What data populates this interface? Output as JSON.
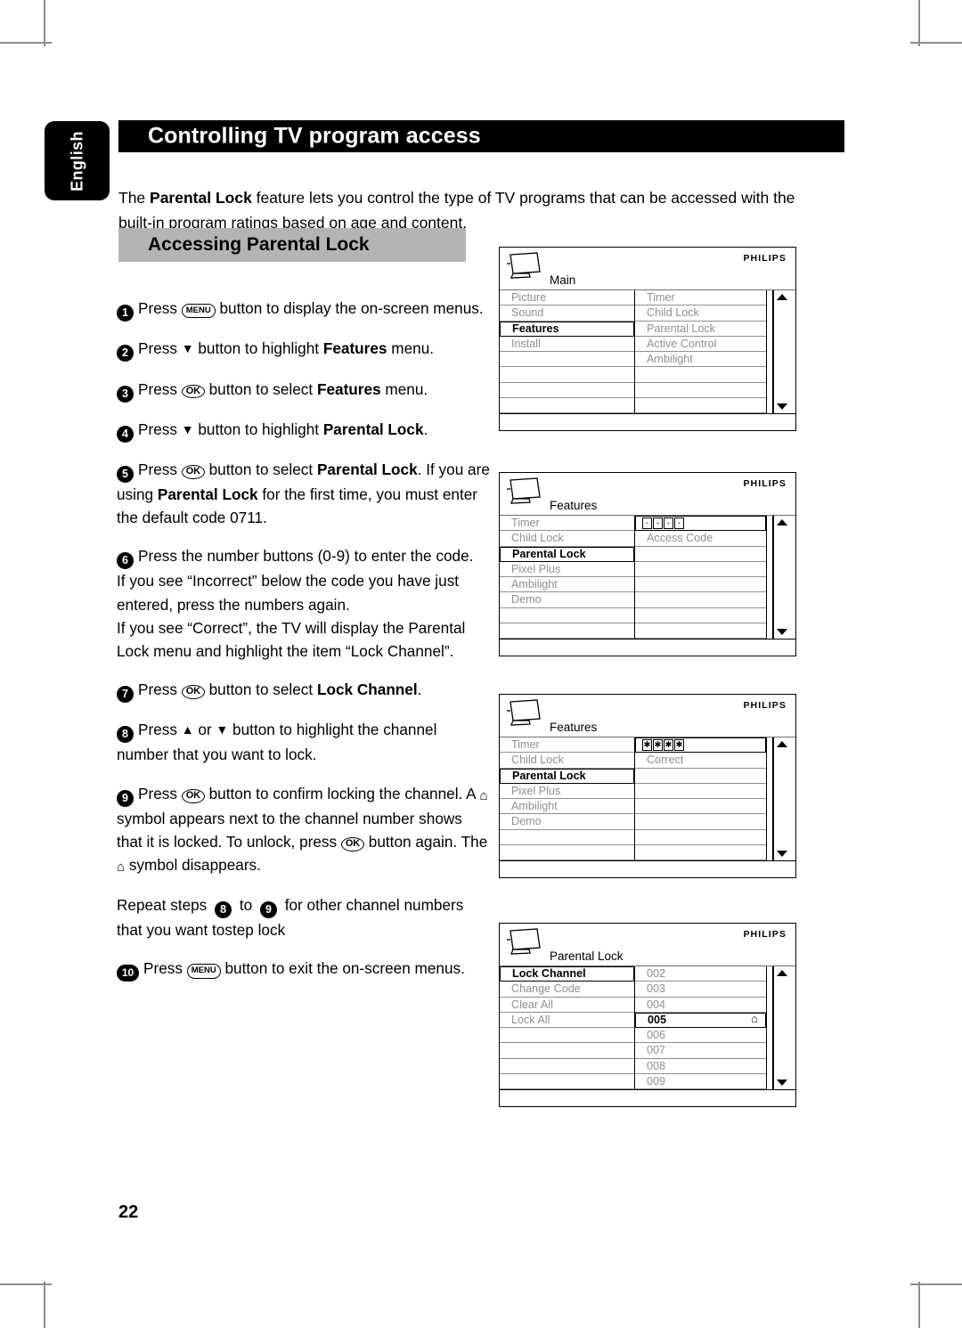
{
  "page": {
    "number": "22",
    "language_tab": "English",
    "title": "Controlling TV program access",
    "intro_prefix": "The ",
    "intro_bold": "Parental Lock",
    "intro_suffix": " feature lets you control the type of TV programs that can be accessed with the built-in program ratings based on age and content.",
    "section_heading": "Accessing Parental Lock"
  },
  "keys": {
    "menu": "MENU",
    "ok": "OK",
    "down": "▼",
    "up": "▲",
    "lock": "⌂"
  },
  "steps": {
    "s1": {
      "num": "1",
      "a": "Press ",
      "key": "MENU",
      "b": " button to display the on-screen menus."
    },
    "s2": {
      "num": "2",
      "a": "Press ",
      "key": "▼",
      "b": " button to highlight ",
      "bold": "Features",
      "c": " menu."
    },
    "s3": {
      "num": "3",
      "a": "Press ",
      "key": "OK",
      "b": " button to select ",
      "bold": "Features",
      "c": " menu."
    },
    "s4": {
      "num": "4",
      "a": "Press ",
      "key": "▼",
      "b": " button to highlight ",
      "bold": "Parental Lock",
      "c": "."
    },
    "s5": {
      "num": "5",
      "a": "Press ",
      "key": "OK",
      "b": " button to select ",
      "bold": "Parental Lock",
      "c": ". If you are using ",
      "bold2": "Parental Lock",
      "d": " for the first time, you must enter the default code 0711."
    },
    "s6": {
      "num": "6",
      "a": "Press the number buttons (0-9) to enter the code.",
      "b": "If you see “Incorrect” below the code you have just entered, press the numbers again.",
      "c": "If you see “Correct”, the TV will display the Parental Lock menu and highlight the item “Lock Channel”."
    },
    "s7": {
      "num": "7",
      "a": "Press ",
      "key": "OK",
      "b": " button to select ",
      "bold": "Lock Channel",
      "c": "."
    },
    "s8": {
      "num": "8",
      "a": "Press ",
      "key_up": "▲",
      "mid": " or ",
      "key_down": "▼",
      "b": " button to highlight the channel number that you want to lock."
    },
    "s9": {
      "num": "9",
      "a": "Press ",
      "key": "OK",
      "b": " button to confirm locking the channel.  A ",
      "lock1": "⌂",
      "c": " symbol appears next to the channel number shows that it is locked. To unlock, press ",
      "key2": "OK",
      "d": " button again. The ",
      "lock2": "⌂",
      "e": " symbol disappears."
    },
    "repeat": {
      "a": "Repeat steps ",
      "from": "8",
      "mid": " to ",
      "to": "9",
      "b": " for other channel numbers that you want tostep lock"
    },
    "s10": {
      "num": "10",
      "a": "Press ",
      "key": "MENU",
      "b": " button to exit the on-screen menus."
    }
  },
  "osd": {
    "brand": "PHILIPS",
    "menu1": {
      "title": "Main",
      "left": [
        {
          "label": "Picture",
          "selected": false
        },
        {
          "label": "Sound",
          "selected": false
        },
        {
          "label": "Features",
          "selected": true
        },
        {
          "label": "Install",
          "selected": false
        },
        {
          "label": "",
          "selected": false
        },
        {
          "label": "",
          "selected": false
        },
        {
          "label": "",
          "selected": false
        },
        {
          "label": "",
          "selected": false
        }
      ],
      "right": [
        {
          "label": "Timer",
          "selected": false
        },
        {
          "label": "Child Lock",
          "selected": false
        },
        {
          "label": "Parental Lock",
          "selected": false
        },
        {
          "label": "Active Control",
          "selected": false
        },
        {
          "label": "Ambilight",
          "selected": false
        },
        {
          "label": "",
          "selected": false
        },
        {
          "label": "",
          "selected": false
        },
        {
          "label": "",
          "selected": false
        }
      ]
    },
    "menu2": {
      "title": "Features",
      "left": [
        {
          "label": "Timer",
          "selected": false
        },
        {
          "label": "Child Lock",
          "selected": false
        },
        {
          "label": "Parental Lock",
          "selected": true
        },
        {
          "label": "Pixel Plus",
          "selected": false
        },
        {
          "label": "Ambilight",
          "selected": false
        },
        {
          "label": "Demo",
          "selected": false
        },
        {
          "label": "",
          "selected": false
        },
        {
          "label": "",
          "selected": false
        }
      ],
      "code_cells": [
        "-",
        "-",
        "-",
        "-"
      ],
      "right": [
        {
          "label": "Access Code",
          "selected": false
        },
        {
          "label": "",
          "selected": false
        },
        {
          "label": "",
          "selected": false
        },
        {
          "label": "",
          "selected": false
        },
        {
          "label": "",
          "selected": false
        },
        {
          "label": "",
          "selected": false
        },
        {
          "label": "",
          "selected": false
        }
      ]
    },
    "menu3": {
      "title": "Features",
      "left": [
        {
          "label": "Timer",
          "selected": false
        },
        {
          "label": "Child Lock",
          "selected": false
        },
        {
          "label": "Parental Lock",
          "selected": true
        },
        {
          "label": "Pixel Plus",
          "selected": false
        },
        {
          "label": "Ambilight",
          "selected": false
        },
        {
          "label": "Demo",
          "selected": false
        },
        {
          "label": "",
          "selected": false
        },
        {
          "label": "",
          "selected": false
        }
      ],
      "code_cells": [
        "✱",
        "✱",
        "✱",
        "✱"
      ],
      "right": [
        {
          "label": "Correct",
          "selected": false
        },
        {
          "label": "",
          "selected": false
        },
        {
          "label": "",
          "selected": false
        },
        {
          "label": "",
          "selected": false
        },
        {
          "label": "",
          "selected": false
        },
        {
          "label": "",
          "selected": false
        },
        {
          "label": "",
          "selected": false
        }
      ]
    },
    "menu4": {
      "title": "Parental Lock",
      "left": [
        {
          "label": "Lock Channel",
          "selected": true
        },
        {
          "label": "Change Code",
          "selected": false
        },
        {
          "label": "Clear All",
          "selected": false
        },
        {
          "label": "Lock All",
          "selected": false
        },
        {
          "label": "",
          "selected": false
        },
        {
          "label": "",
          "selected": false
        },
        {
          "label": "",
          "selected": false
        },
        {
          "label": "",
          "selected": false
        }
      ],
      "right": [
        {
          "label": "002",
          "selected": false,
          "lock": false
        },
        {
          "label": "003",
          "selected": false,
          "lock": false
        },
        {
          "label": "004",
          "selected": false,
          "lock": false
        },
        {
          "label": "005",
          "selected": true,
          "lock": true
        },
        {
          "label": "006",
          "selected": false,
          "lock": false
        },
        {
          "label": "007",
          "selected": false,
          "lock": false
        },
        {
          "label": "008",
          "selected": false,
          "lock": false
        },
        {
          "label": "009",
          "selected": false,
          "lock": false
        }
      ]
    }
  }
}
